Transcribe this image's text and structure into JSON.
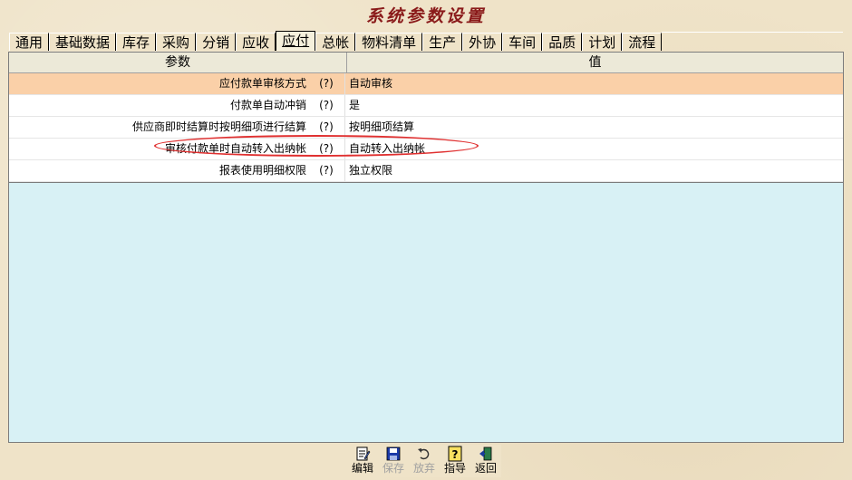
{
  "window": {
    "title": "系统参数设置"
  },
  "tabs": [
    {
      "label": "通用"
    },
    {
      "label": "基础数据"
    },
    {
      "label": "库存"
    },
    {
      "label": "采购"
    },
    {
      "label": "分销"
    },
    {
      "label": "应收"
    },
    {
      "label": "应付",
      "active": true
    },
    {
      "label": "总帐"
    },
    {
      "label": "物料清单"
    },
    {
      "label": "生产"
    },
    {
      "label": "外协"
    },
    {
      "label": "车间"
    },
    {
      "label": "品质"
    },
    {
      "label": "计划"
    },
    {
      "label": "流程"
    }
  ],
  "grid": {
    "headers": {
      "param": "参数",
      "value": "值"
    },
    "rows": [
      {
        "name": "应付款单审核方式",
        "help": "(?)",
        "value": "自动审核",
        "selected": true
      },
      {
        "name": "付款单自动冲销",
        "help": "(?)",
        "value": "是"
      },
      {
        "name": "供应商即时结算时按明细项进行结算",
        "help": "(?)",
        "value": "按明细项结算"
      },
      {
        "name": "审核付款单时自动转入出纳帐",
        "help": "(?)",
        "value": "自动转入出纳帐",
        "highlighted": true
      },
      {
        "name": "报表使用明细权限",
        "help": "(?)",
        "value": "独立权限"
      }
    ]
  },
  "toolbar": {
    "edit": "编辑",
    "save": "保存",
    "discard": "放弃",
    "guide": "指导",
    "back": "返回"
  },
  "colors": {
    "title": "#8a1a1a",
    "selected_row": "#fad0a8",
    "grid_bg": "#d8f1f5",
    "annotation": "#e03030"
  },
  "icons": [
    "edit-icon",
    "save-icon",
    "undo-icon",
    "help-icon",
    "exit-icon"
  ]
}
